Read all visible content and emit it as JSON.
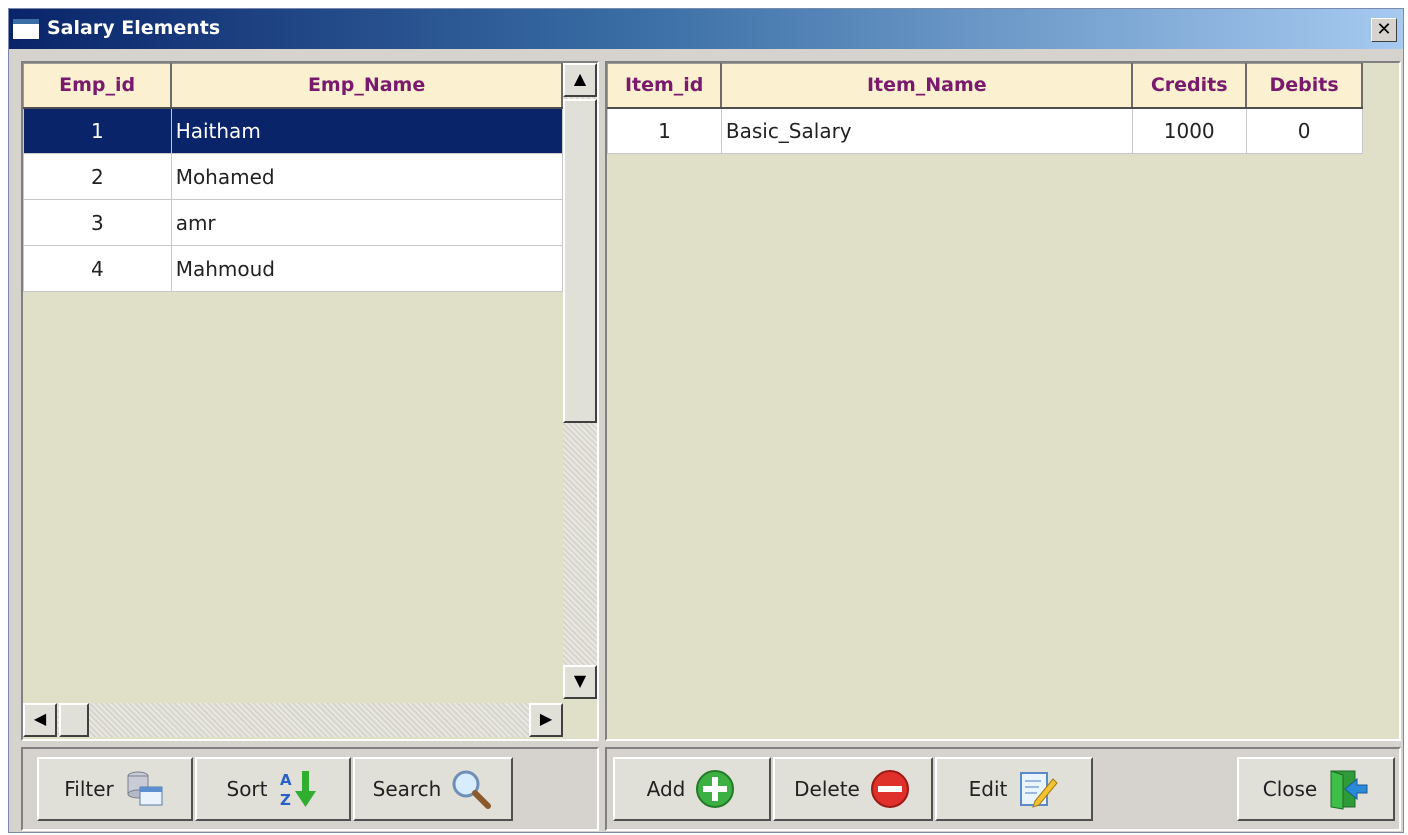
{
  "window": {
    "title": "Salary Elements",
    "close_glyph": "✕"
  },
  "employees": {
    "headers": {
      "id": "Emp_id",
      "name": "Emp_Name"
    },
    "rows": [
      {
        "id": "1",
        "name": "Haitham",
        "selected": true
      },
      {
        "id": "2",
        "name": "Mohamed"
      },
      {
        "id": "3",
        "name": "amr"
      },
      {
        "id": "4",
        "name": "Mahmoud"
      }
    ]
  },
  "items": {
    "headers": {
      "id": "Item_id",
      "name": "Item_Name",
      "credits": "Credits",
      "debits": "Debits"
    },
    "rows": [
      {
        "id": "1",
        "name": "Basic_Salary",
        "credits": "1000",
        "debits": "0"
      }
    ]
  },
  "scrollbar": {
    "up": "▲",
    "down": "▼",
    "left": "◀",
    "right": "▶"
  },
  "left_toolbar": {
    "filter": {
      "label": "Filter",
      "icon": "filter-icon"
    },
    "sort": {
      "label": "Sort",
      "icon": "sort-az-icon"
    },
    "search": {
      "label": "Search",
      "icon": "search-icon"
    }
  },
  "right_toolbar": {
    "add": {
      "label": "Add",
      "icon": "add-icon"
    },
    "delete": {
      "label": "Delete",
      "icon": "delete-icon"
    },
    "edit": {
      "label": "Edit",
      "icon": "edit-icon"
    },
    "close": {
      "label": "Close",
      "icon": "exit-door-icon"
    }
  },
  "colors": {
    "selection": "#0a246a",
    "header_bg": "#fbf0d0",
    "header_text": "#7a1a6c",
    "panel_bg": "#e0dfc7"
  }
}
